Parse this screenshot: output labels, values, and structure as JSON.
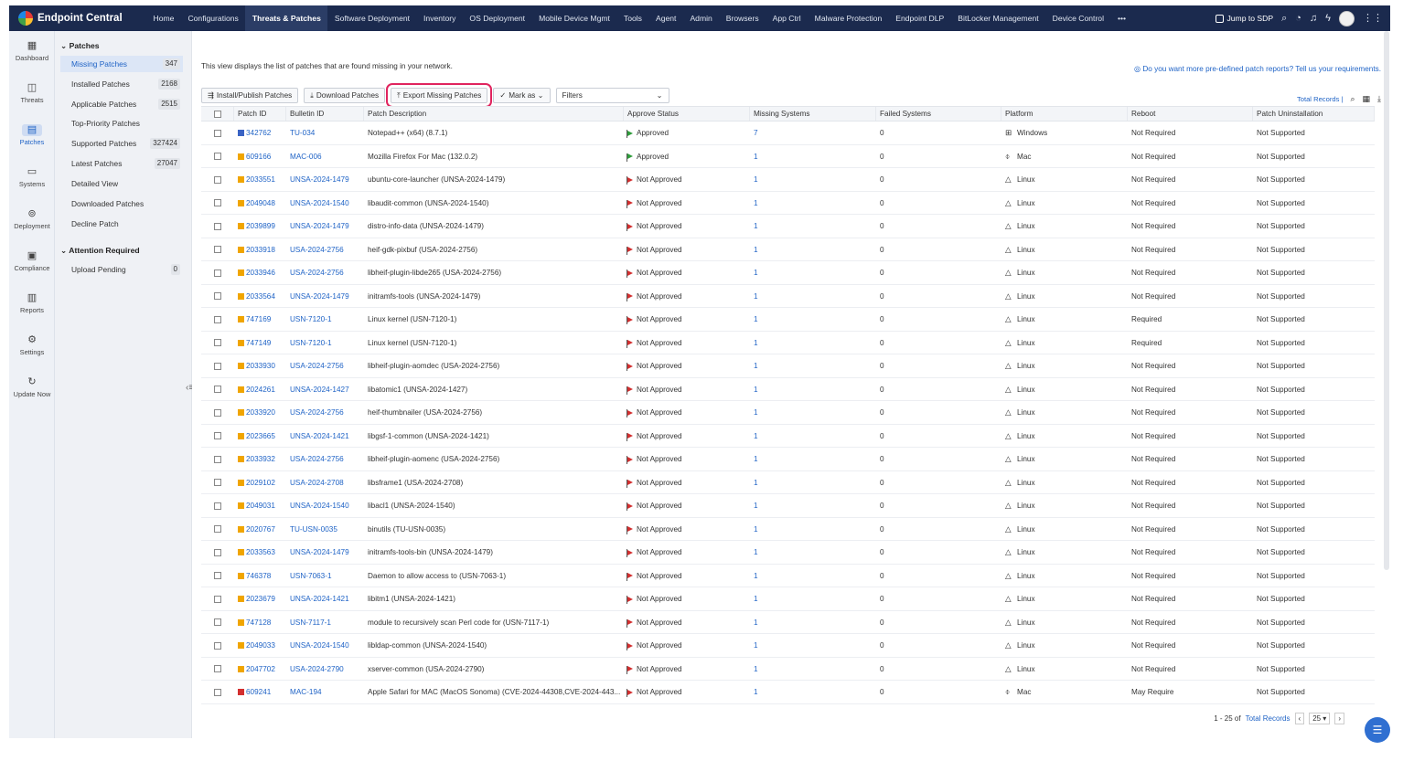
{
  "app": {
    "brand": "Endpoint Central"
  },
  "topnav": {
    "items": [
      "Home",
      "Configurations",
      "Threats & Patches",
      "Software Deployment",
      "Inventory",
      "OS Deployment",
      "Mobile Device Mgmt",
      "Tools",
      "Agent",
      "Admin",
      "Browsers",
      "App Ctrl",
      "Malware Protection",
      "Endpoint DLP",
      "BitLocker Management",
      "Device Control"
    ],
    "active": "Threats & Patches",
    "more": "•••",
    "jump_label": "Jump to SDP"
  },
  "rail": {
    "items": [
      {
        "label": "Dashboard",
        "icon": "dashboard-icon",
        "glyph": "▦"
      },
      {
        "label": "Threats",
        "icon": "threats-icon",
        "glyph": "◫"
      },
      {
        "label": "Patches",
        "icon": "patches-icon",
        "glyph": "▤"
      },
      {
        "label": "Systems",
        "icon": "systems-icon",
        "glyph": "▭"
      },
      {
        "label": "Deployment",
        "icon": "deployment-icon",
        "glyph": "⊚"
      },
      {
        "label": "Compliance",
        "icon": "compliance-icon",
        "glyph": "▣"
      },
      {
        "label": "Reports",
        "icon": "reports-icon",
        "glyph": "▥"
      },
      {
        "label": "Settings",
        "icon": "settings-icon",
        "glyph": "⚙"
      },
      {
        "label": "Update Now",
        "icon": "update-icon",
        "glyph": "↻"
      }
    ],
    "active": "Patches"
  },
  "submenu": {
    "group1": "Patches",
    "items": [
      {
        "label": "Missing Patches",
        "count": "347"
      },
      {
        "label": "Installed Patches",
        "count": "2168"
      },
      {
        "label": "Applicable Patches",
        "count": "2515"
      },
      {
        "label": "Top-Priority Patches",
        "count": ""
      },
      {
        "label": "Supported Patches",
        "count": "327424"
      },
      {
        "label": "Latest Patches",
        "count": "27047"
      },
      {
        "label": "Detailed View",
        "count": ""
      },
      {
        "label": "Downloaded Patches",
        "count": ""
      },
      {
        "label": "Decline Patch",
        "count": ""
      }
    ],
    "group2": "Attention Required",
    "items2": [
      {
        "label": "Upload Pending",
        "count": "0"
      }
    ]
  },
  "main": {
    "description": "This view displays the list of patches that are found missing in your network.",
    "promo": "Do you want more pre-defined patch reports? Tell us your requirements.",
    "toolbar": {
      "install": "Install/Publish Patches",
      "download": "Download Patches",
      "export": "Export Missing Patches",
      "mark_as": "Mark as",
      "filters": "Filters"
    },
    "total_records": "Total Records |",
    "columns": [
      "Patch ID",
      "Bulletin ID",
      "Patch Description",
      "Approve Status",
      "Missing Systems",
      "Failed Systems",
      "Platform",
      "Reboot",
      "Patch Uninstallation"
    ],
    "rows": [
      {
        "sev": "low",
        "id": "342762",
        "bulletin": "TU-034",
        "desc": "Notepad++ (x64) (8.7.1)",
        "status": "Approved",
        "missing": "7",
        "failed": "0",
        "platform": "Windows",
        "reboot": "Not Required",
        "uninstall": "Not Supported"
      },
      {
        "sev": "mod",
        "id": "609166",
        "bulletin": "MAC-006",
        "desc": "Mozilla Firefox For Mac (132.0.2)",
        "status": "Approved",
        "missing": "1",
        "failed": "0",
        "platform": "Mac",
        "reboot": "Not Required",
        "uninstall": "Not Supported"
      },
      {
        "sev": "mod",
        "id": "2033551",
        "bulletin": "UNSA-2024-1479",
        "desc": "ubuntu-core-launcher (UNSA-2024-1479)",
        "status": "Not Approved",
        "missing": "1",
        "failed": "0",
        "platform": "Linux",
        "reboot": "Not Required",
        "uninstall": "Not Supported"
      },
      {
        "sev": "mod",
        "id": "2049048",
        "bulletin": "UNSA-2024-1540",
        "desc": "libaudit-common (UNSA-2024-1540)",
        "status": "Not Approved",
        "missing": "1",
        "failed": "0",
        "platform": "Linux",
        "reboot": "Not Required",
        "uninstall": "Not Supported"
      },
      {
        "sev": "mod",
        "id": "2039899",
        "bulletin": "UNSA-2024-1479",
        "desc": "distro-info-data (UNSA-2024-1479)",
        "status": "Not Approved",
        "missing": "1",
        "failed": "0",
        "platform": "Linux",
        "reboot": "Not Required",
        "uninstall": "Not Supported"
      },
      {
        "sev": "mod",
        "id": "2033918",
        "bulletin": "USA-2024-2756",
        "desc": "heif-gdk-pixbuf (USA-2024-2756)",
        "status": "Not Approved",
        "missing": "1",
        "failed": "0",
        "platform": "Linux",
        "reboot": "Not Required",
        "uninstall": "Not Supported"
      },
      {
        "sev": "mod",
        "id": "2033946",
        "bulletin": "USA-2024-2756",
        "desc": "libheif-plugin-libde265 (USA-2024-2756)",
        "status": "Not Approved",
        "missing": "1",
        "failed": "0",
        "platform": "Linux",
        "reboot": "Not Required",
        "uninstall": "Not Supported"
      },
      {
        "sev": "mod",
        "id": "2033564",
        "bulletin": "UNSA-2024-1479",
        "desc": "initramfs-tools (UNSA-2024-1479)",
        "status": "Not Approved",
        "missing": "1",
        "failed": "0",
        "platform": "Linux",
        "reboot": "Not Required",
        "uninstall": "Not Supported"
      },
      {
        "sev": "mod",
        "id": "747169",
        "bulletin": "USN-7120-1",
        "desc": "Linux kernel (USN-7120-1)",
        "status": "Not Approved",
        "missing": "1",
        "failed": "0",
        "platform": "Linux",
        "reboot": "Required",
        "uninstall": "Not Supported"
      },
      {
        "sev": "mod",
        "id": "747149",
        "bulletin": "USN-7120-1",
        "desc": "Linux kernel (USN-7120-1)",
        "status": "Not Approved",
        "missing": "1",
        "failed": "0",
        "platform": "Linux",
        "reboot": "Required",
        "uninstall": "Not Supported"
      },
      {
        "sev": "mod",
        "id": "2033930",
        "bulletin": "USA-2024-2756",
        "desc": "libheif-plugin-aomdec (USA-2024-2756)",
        "status": "Not Approved",
        "missing": "1",
        "failed": "0",
        "platform": "Linux",
        "reboot": "Not Required",
        "uninstall": "Not Supported"
      },
      {
        "sev": "mod",
        "id": "2024261",
        "bulletin": "UNSA-2024-1427",
        "desc": "libatomic1 (UNSA-2024-1427)",
        "status": "Not Approved",
        "missing": "1",
        "failed": "0",
        "platform": "Linux",
        "reboot": "Not Required",
        "uninstall": "Not Supported"
      },
      {
        "sev": "mod",
        "id": "2033920",
        "bulletin": "USA-2024-2756",
        "desc": "heif-thumbnailer (USA-2024-2756)",
        "status": "Not Approved",
        "missing": "1",
        "failed": "0",
        "platform": "Linux",
        "reboot": "Not Required",
        "uninstall": "Not Supported"
      },
      {
        "sev": "mod",
        "id": "2023665",
        "bulletin": "UNSA-2024-1421",
        "desc": "libgsf-1-common (UNSA-2024-1421)",
        "status": "Not Approved",
        "missing": "1",
        "failed": "0",
        "platform": "Linux",
        "reboot": "Not Required",
        "uninstall": "Not Supported"
      },
      {
        "sev": "mod",
        "id": "2033932",
        "bulletin": "USA-2024-2756",
        "desc": "libheif-plugin-aomenc (USA-2024-2756)",
        "status": "Not Approved",
        "missing": "1",
        "failed": "0",
        "platform": "Linux",
        "reboot": "Not Required",
        "uninstall": "Not Supported"
      },
      {
        "sev": "mod",
        "id": "2029102",
        "bulletin": "USA-2024-2708",
        "desc": "libsframe1 (USA-2024-2708)",
        "status": "Not Approved",
        "missing": "1",
        "failed": "0",
        "platform": "Linux",
        "reboot": "Not Required",
        "uninstall": "Not Supported"
      },
      {
        "sev": "mod",
        "id": "2049031",
        "bulletin": "UNSA-2024-1540",
        "desc": "libacl1 (UNSA-2024-1540)",
        "status": "Not Approved",
        "missing": "1",
        "failed": "0",
        "platform": "Linux",
        "reboot": "Not Required",
        "uninstall": "Not Supported"
      },
      {
        "sev": "mod",
        "id": "2020767",
        "bulletin": "TU-USN-0035",
        "desc": "binutils (TU-USN-0035)",
        "status": "Not Approved",
        "missing": "1",
        "failed": "0",
        "platform": "Linux",
        "reboot": "Not Required",
        "uninstall": "Not Supported"
      },
      {
        "sev": "mod",
        "id": "2033563",
        "bulletin": "UNSA-2024-1479",
        "desc": "initramfs-tools-bin (UNSA-2024-1479)",
        "status": "Not Approved",
        "missing": "1",
        "failed": "0",
        "platform": "Linux",
        "reboot": "Not Required",
        "uninstall": "Not Supported"
      },
      {
        "sev": "mod",
        "id": "746378",
        "bulletin": "USN-7063-1",
        "desc": "Daemon to allow access to (USN-7063-1)",
        "status": "Not Approved",
        "missing": "1",
        "failed": "0",
        "platform": "Linux",
        "reboot": "Not Required",
        "uninstall": "Not Supported"
      },
      {
        "sev": "mod",
        "id": "2023679",
        "bulletin": "UNSA-2024-1421",
        "desc": "libitm1 (UNSA-2024-1421)",
        "status": "Not Approved",
        "missing": "1",
        "failed": "0",
        "platform": "Linux",
        "reboot": "Not Required",
        "uninstall": "Not Supported"
      },
      {
        "sev": "mod",
        "id": "747128",
        "bulletin": "USN-7117-1",
        "desc": "module to recursively scan Perl code for (USN-7117-1)",
        "status": "Not Approved",
        "missing": "1",
        "failed": "0",
        "platform": "Linux",
        "reboot": "Not Required",
        "uninstall": "Not Supported"
      },
      {
        "sev": "mod",
        "id": "2049033",
        "bulletin": "UNSA-2024-1540",
        "desc": "libldap-common (UNSA-2024-1540)",
        "status": "Not Approved",
        "missing": "1",
        "failed": "0",
        "platform": "Linux",
        "reboot": "Not Required",
        "uninstall": "Not Supported"
      },
      {
        "sev": "mod",
        "id": "2047702",
        "bulletin": "USA-2024-2790",
        "desc": "xserver-common (USA-2024-2790)",
        "status": "Not Approved",
        "missing": "1",
        "failed": "0",
        "platform": "Linux",
        "reboot": "Not Required",
        "uninstall": "Not Supported"
      },
      {
        "sev": "crit",
        "id": "609241",
        "bulletin": "MAC-194",
        "desc": "Apple Safari for MAC (MacOS Sonoma) (CVE-2024-44308,CVE-2024-443...",
        "status": "Not Approved",
        "missing": "1",
        "failed": "0",
        "platform": "Mac",
        "reboot": "May Require",
        "uninstall": "Not Supported"
      }
    ],
    "pager": {
      "range": "1 - 25 of",
      "total_link": "Total Records",
      "prev": "‹",
      "per_page": "25 ▾",
      "next": "›"
    }
  },
  "colors": {
    "nav_bg": "#1b2a4e",
    "accent": "#1f63c6",
    "highlight": "#e0245e",
    "approved": "#2e9c3a",
    "not_approved": "#d32f2f"
  }
}
